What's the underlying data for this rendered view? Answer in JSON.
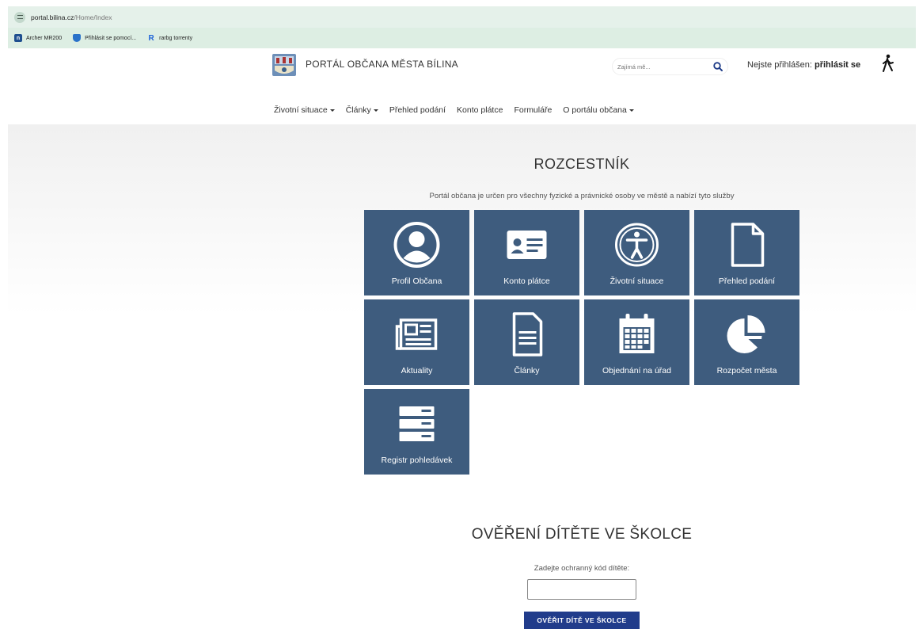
{
  "browser": {
    "url_host": "portal.bilina.cz",
    "url_path": "/Home/Index",
    "bookmarks": [
      {
        "label": "Archer MR200",
        "icon": "archer-icon"
      },
      {
        "label": "Přihlásit se pomocí...",
        "icon": "shield-icon"
      },
      {
        "label": "rarbg torrenty",
        "icon": "r-icon"
      }
    ]
  },
  "header": {
    "title": "PORTÁL OBČANA MĚSTA BÍLINA",
    "search_placeholder": "Zajímá mě...",
    "login_prefix": "Nejste přihlášen:",
    "login_link": "přihlásit se"
  },
  "nav": {
    "items": [
      {
        "label": "Životní situace",
        "dropdown": true
      },
      {
        "label": "Články",
        "dropdown": true
      },
      {
        "label": "Přehled podání",
        "dropdown": false
      },
      {
        "label": "Konto plátce",
        "dropdown": false
      },
      {
        "label": "Formuláře",
        "dropdown": false
      },
      {
        "label": "O portálu občana",
        "dropdown": true
      }
    ]
  },
  "main": {
    "title": "ROZCESTNÍK",
    "subtitle": "Portál občana je určen pro všechny fyzické a právnické osoby ve městě a nabízí tyto služby",
    "tile_color": "#3e5c7e",
    "tiles": [
      {
        "label": "Profil Občana",
        "icon": "user-profile-icon"
      },
      {
        "label": "Konto plátce",
        "icon": "id-card-icon"
      },
      {
        "label": "Životní situace",
        "icon": "accessibility-person-icon"
      },
      {
        "label": "Přehled podání",
        "icon": "document-icon"
      },
      {
        "label": "Aktuality",
        "icon": "newspaper-icon"
      },
      {
        "label": "Články",
        "icon": "article-icon"
      },
      {
        "label": "Objednání na úřad",
        "icon": "calendar-icon"
      },
      {
        "label": "Rozpočet města",
        "icon": "pie-chart-icon"
      },
      {
        "label": "Registr pohledávek",
        "icon": "register-list-icon"
      }
    ]
  },
  "kindergarten": {
    "title": "OVĚŘENÍ DÍTĚTE VE ŠKOLCE",
    "label": "Zadejte ochranný kód dítěte:",
    "input_value": "",
    "button_label": "OVĚŘIT DÍTĚ VE ŠKOLCE",
    "button_color": "#213c8b"
  }
}
